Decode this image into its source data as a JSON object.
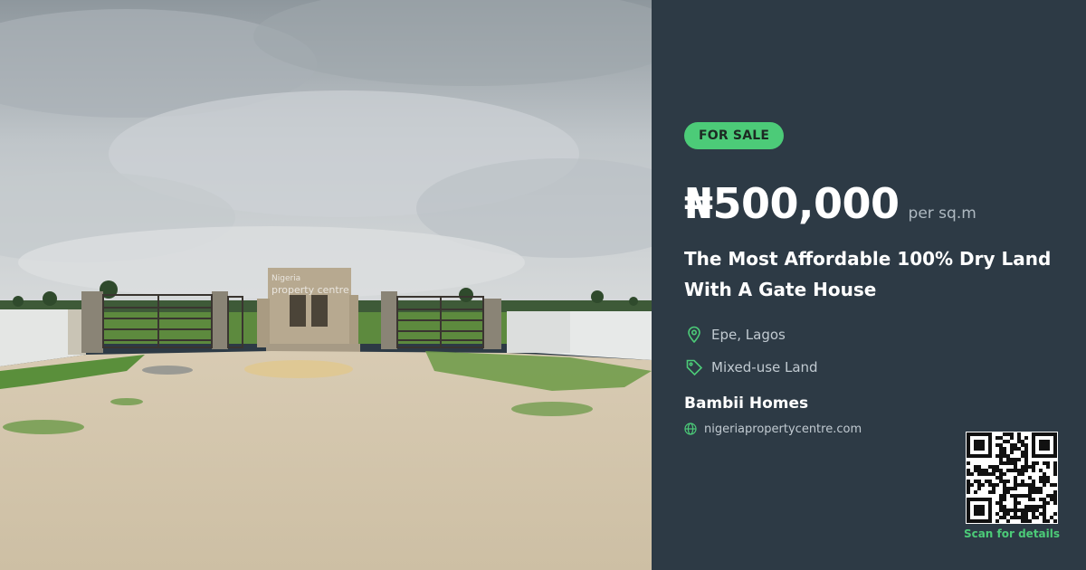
{
  "photo": {
    "alt": "Walled land plot with gates and a small gate house under a cloudy sky",
    "watermark": "Nigeria property centre"
  },
  "listing": {
    "status_badge": "FOR SALE",
    "price": "₦500,000",
    "price_unit": "per sq.m",
    "title": "The Most Affordable 100% Dry Land With A Gate House",
    "location": "Epe, Lagos",
    "property_type": "Mixed-use Land",
    "agent_name": "Bambii Homes",
    "website": "nigeriapropertycentre.com",
    "qr_caption": "Scan for details"
  },
  "icons": {
    "location": "map-pin-icon",
    "type": "tag-icon",
    "website": "globe-icon"
  },
  "colors": {
    "panel_bg": "#2d3a45",
    "accent_green": "#4ccb78",
    "text_white": "#ffffff",
    "text_muted": "#c1cad1"
  }
}
